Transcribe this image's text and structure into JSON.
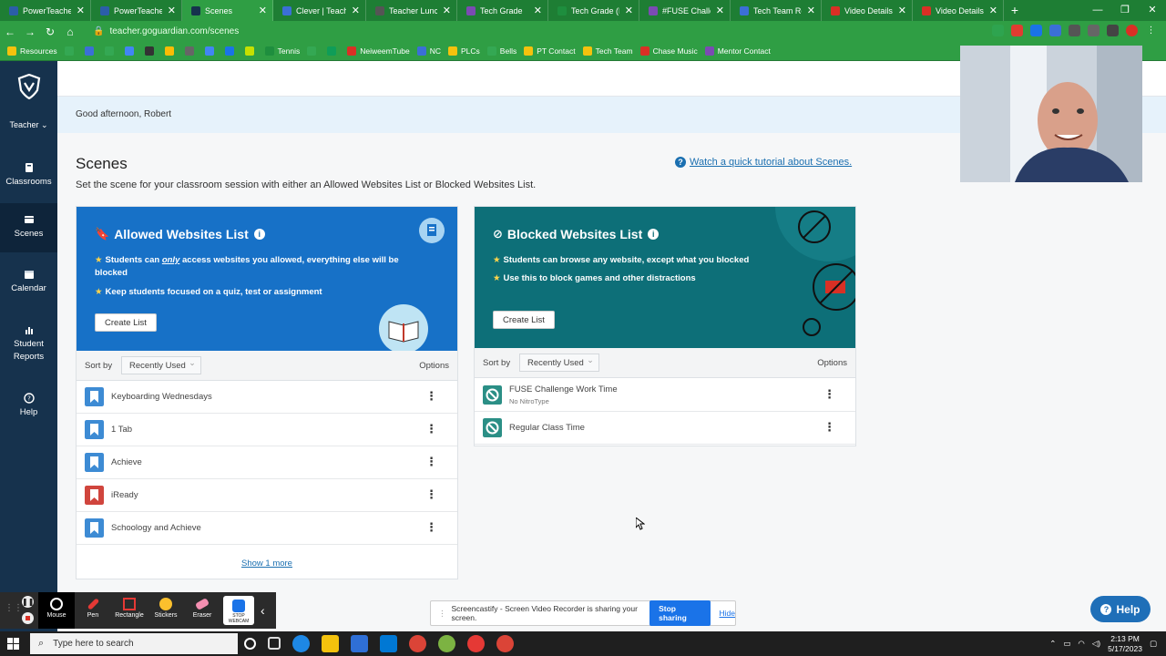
{
  "browser": {
    "tabs": [
      {
        "label": "PowerTeacher",
        "color": "#2b5ea8",
        "active": false
      },
      {
        "label": "PowerTeacher P",
        "color": "#2b5ea8",
        "active": false
      },
      {
        "label": "Scenes",
        "color": "#16324d",
        "active": true
      },
      {
        "label": "Clever | Teacher",
        "color": "#3b6fd6",
        "active": false
      },
      {
        "label": "Teacher Lunch T",
        "color": "#555555",
        "active": false
      },
      {
        "label": "Tech Grade",
        "color": "#7b4bb3",
        "active": false
      },
      {
        "label": "Tech Grade (Re",
        "color": "#1e8e3e",
        "active": false
      },
      {
        "label": "#FUSE Challeng",
        "color": "#7b4bb3",
        "active": false
      },
      {
        "label": "Tech Team Reso",
        "color": "#3b6fd6",
        "active": false
      },
      {
        "label": "Video Details -",
        "color": "#d93025",
        "active": false
      },
      {
        "label": "Video Details -",
        "color": "#d93025",
        "active": false
      }
    ],
    "url": "teacher.goguardian.com/scenes",
    "bookmarks": [
      {
        "label": "Resources",
        "color": "#f4c20d"
      },
      {
        "label": "",
        "color": "#34a853"
      },
      {
        "label": "",
        "color": "#3b6fd6"
      },
      {
        "label": "",
        "color": "#34a853"
      },
      {
        "label": "",
        "color": "#4285f4"
      },
      {
        "label": "",
        "color": "#333333"
      },
      {
        "label": "",
        "color": "#fbbc05"
      },
      {
        "label": "",
        "color": "#666666"
      },
      {
        "label": "",
        "color": "#4285f4"
      },
      {
        "label": "",
        "color": "#1a73e8"
      },
      {
        "label": "",
        "color": "#c6e000"
      },
      {
        "label": "Tennis",
        "color": "#1e8e3e"
      },
      {
        "label": "",
        "color": "#34a853"
      },
      {
        "label": "",
        "color": "#0f9d58"
      },
      {
        "label": "NeiweemTube",
        "color": "#d93025"
      },
      {
        "label": "NC",
        "color": "#3b6fd6"
      },
      {
        "label": "PLCs",
        "color": "#f4c20d"
      },
      {
        "label": "Bells",
        "color": "#34a853"
      },
      {
        "label": "PT Contact",
        "color": "#f4c20d"
      },
      {
        "label": "Tech Team",
        "color": "#f4c20d"
      },
      {
        "label": "Chase Music",
        "color": "#d93025"
      },
      {
        "label": "Mentor Contact",
        "color": "#7b4bb3"
      }
    ]
  },
  "sidebar": {
    "teacher_label": "Teacher",
    "items": [
      {
        "label": "Classrooms",
        "icon": "book-icon",
        "active": false
      },
      {
        "label": "Scenes",
        "icon": "scenes-icon",
        "active": true
      },
      {
        "label": "Calendar",
        "icon": "calendar-icon",
        "active": false
      },
      {
        "label": "Student Reports",
        "icon": "bar-chart-icon",
        "active": false
      },
      {
        "label": "Help",
        "icon": "help-icon",
        "active": false
      }
    ]
  },
  "greeting": "Good afternoon, Robert",
  "page": {
    "title": "Scenes",
    "subtitle": "Set the scene for your classroom session with either an Allowed Websites List or Blocked Websites List.",
    "tutorial_link": "Watch a quick tutorial about Scenes."
  },
  "allowed": {
    "title": "Allowed Websites List",
    "bullet1_pre": "Students can ",
    "bullet1_em": "only",
    "bullet1_post": " access websites you allowed, everything else will be blocked",
    "bullet2": "Keep students focused on a quiz, test or assignment",
    "create_label": "Create List",
    "sort_label": "Sort by",
    "sort_value": "Recently Used",
    "options_label": "Options",
    "items": [
      {
        "label": "Keyboarding Wednesdays",
        "color": "#3d8bd4"
      },
      {
        "label": "1 Tab",
        "color": "#3d8bd4"
      },
      {
        "label": "Achieve",
        "color": "#3d8bd4"
      },
      {
        "label": "iReady",
        "color": "#d0453d"
      },
      {
        "label": "Schoology and Achieve",
        "color": "#3d8bd4"
      }
    ],
    "show_more": "Show 1 more",
    "hero_color": "#1771c7"
  },
  "blocked": {
    "title": "Blocked Websites List",
    "bullet1": "Students can browse any website, except what you blocked",
    "bullet2": "Use this to block games and other distractions",
    "create_label": "Create List",
    "sort_label": "Sort by",
    "sort_value": "Recently Used",
    "options_label": "Options",
    "items": [
      {
        "label": "FUSE Challenge Work Time",
        "sub": "No NitroType",
        "color": "#2b8f86"
      },
      {
        "label": "Regular Class Time",
        "sub": "",
        "color": "#2b8f86"
      }
    ],
    "hero_color": "#0d6f78"
  },
  "screencastify": {
    "tools": [
      "Mouse",
      "Pen",
      "Rectangle",
      "Stickers",
      "Eraser",
      "STOP WEBCAM"
    ],
    "share_text": "Screencastify - Screen Video Recorder is sharing your screen.",
    "stop_label": "Stop sharing",
    "hide_label": "Hide"
  },
  "help_button": "Help",
  "taskbar": {
    "search_placeholder": "Type here to search",
    "time": "2:13 PM",
    "date": "5/17/2023"
  }
}
